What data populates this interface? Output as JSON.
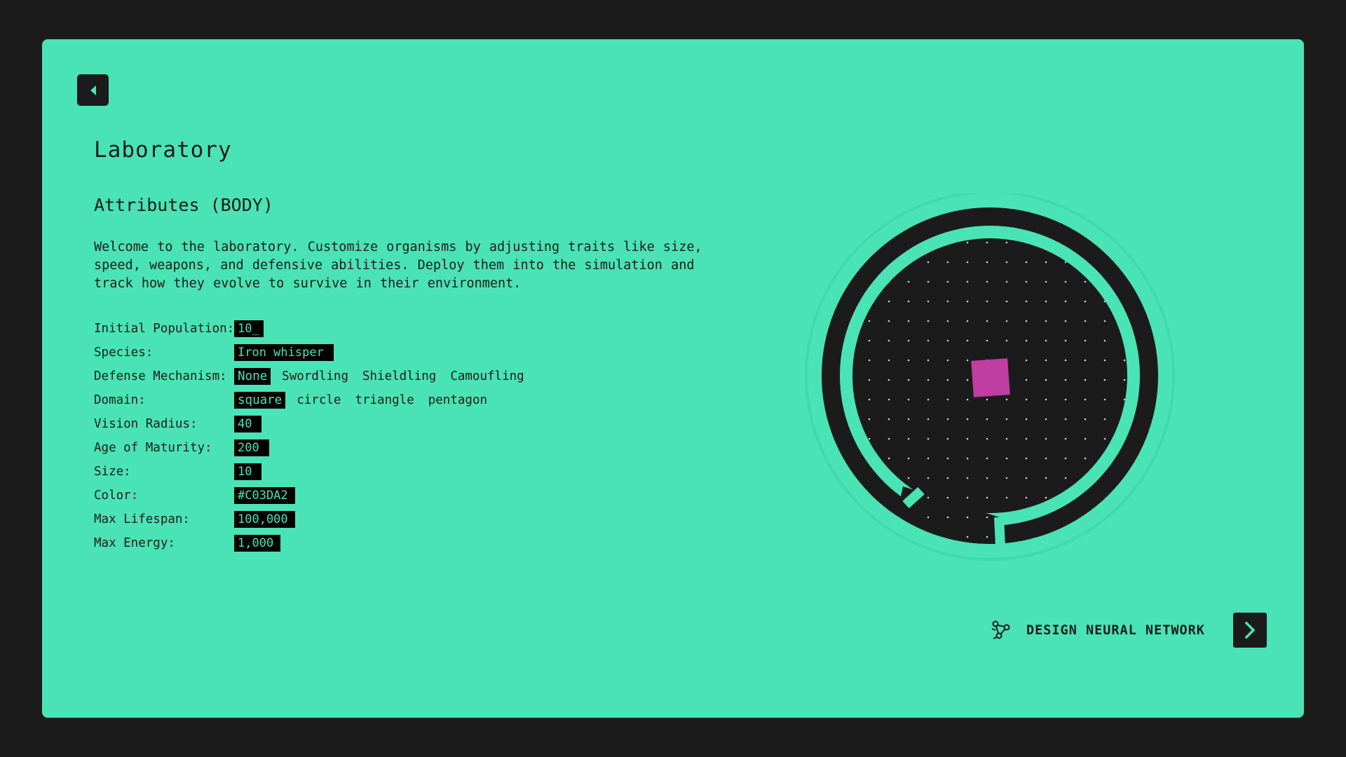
{
  "page": {
    "title": "Laboratory",
    "section_title": "Attributes (BODY)",
    "intro": "Welcome to the laboratory. Customize organisms by adjusting traits like size, speed, weapons, and defensive abilities. Deploy them into the simulation and track how they evolve to survive in their environment."
  },
  "attributes": {
    "initial_population": {
      "label": "Initial Population:",
      "value": "10_"
    },
    "species": {
      "label": "Species:",
      "value": "Iron whisper"
    },
    "defense": {
      "label": "Defense Mechanism:",
      "options": [
        "None",
        "Swordling",
        "Shieldling",
        "Camoufling"
      ],
      "selected": "None"
    },
    "domain": {
      "label": "Domain:",
      "options": [
        "square",
        "circle",
        "triangle",
        "pentagon"
      ],
      "selected": "square"
    },
    "vision_radius": {
      "label": "Vision Radius:",
      "value": "40"
    },
    "age_of_maturity": {
      "label": "Age of Maturity:",
      "value": "200"
    },
    "size": {
      "label": "Size:",
      "value": "10"
    },
    "color": {
      "label": "Color:",
      "value": "#C03DA2"
    },
    "max_lifespan": {
      "label": "Max Lifespan:",
      "value": "100,000"
    },
    "max_energy": {
      "label": "Max Energy:",
      "value": "1,000"
    }
  },
  "preview": {
    "organism_color": "#c03da2",
    "arena_color": "#1b1b1c"
  },
  "cta": {
    "label": "DESIGN NEURAL NETWORK",
    "icon": "network-icon"
  },
  "navigation": {
    "back_icon": "arrow-left-icon",
    "next_icon": "chevron-right-icon"
  },
  "theme": {
    "background": "#1b1b1c",
    "panel": "#4ae3b5",
    "accent": "#c03da2"
  }
}
